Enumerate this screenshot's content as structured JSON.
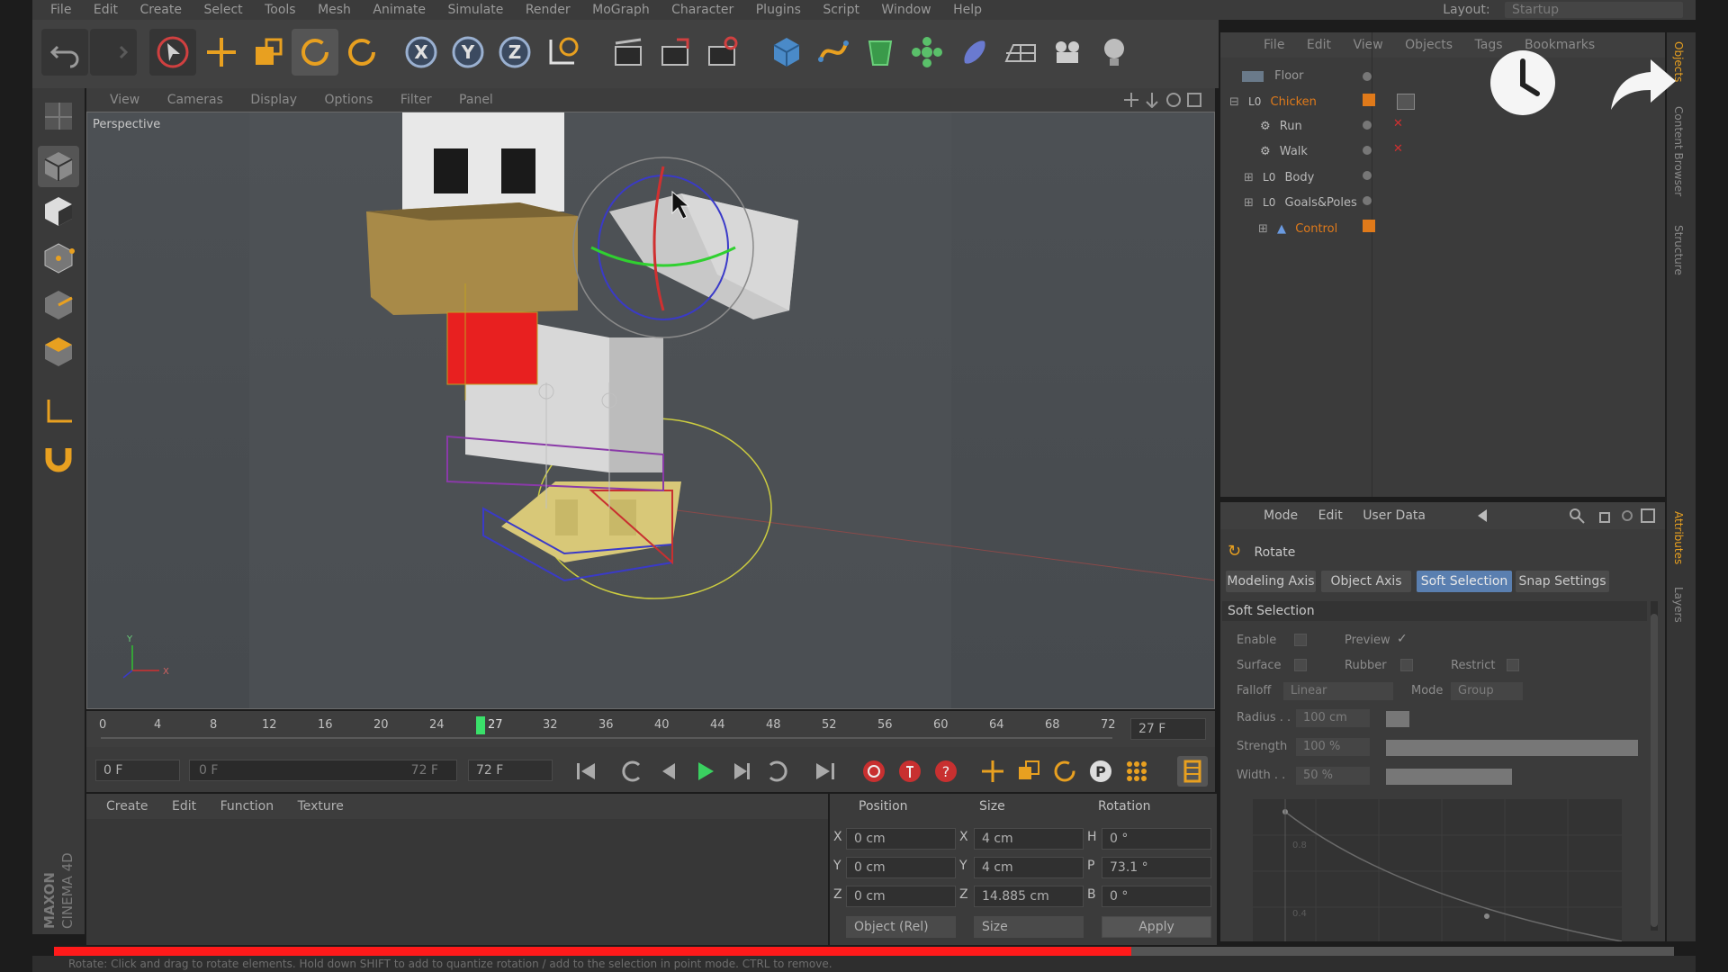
{
  "app": {
    "menu": [
      "File",
      "Edit",
      "Create",
      "Select",
      "Tools",
      "Mesh",
      "Animate",
      "Simulate",
      "Render",
      "MoGraph",
      "Character",
      "Plugins",
      "Script",
      "Window",
      "Help"
    ],
    "layout_label": "Layout:",
    "layout_value": "Startup",
    "brand_maxon": "MAXON",
    "brand_product": "CINEMA 4D"
  },
  "toolbar": {
    "icons": [
      "undo-icon",
      "redo-icon",
      "live-select-icon",
      "move-icon",
      "scale-icon",
      "rotate-icon",
      "recent-rotate-icon",
      "x-axis-lock-icon",
      "y-axis-lock-icon",
      "z-axis-lock-icon",
      "coordinate-system-icon",
      "render-view-icon",
      "render-picture-viewer-icon",
      "render-settings-icon",
      "cube-primitive-icon",
      "spline-icon",
      "nurbs-icon",
      "array-icon",
      "deformer-icon",
      "floor-icon",
      "camera-icon",
      "light-icon"
    ],
    "axis_x": "X",
    "axis_y": "Y",
    "axis_z": "Z"
  },
  "viewport": {
    "menu": [
      "View",
      "Cameras",
      "Display",
      "Options",
      "Filter",
      "Panel"
    ],
    "label": "Perspective",
    "axis_x": "X",
    "axis_y": "Y"
  },
  "timeline": {
    "ticks": [
      "0",
      "4",
      "8",
      "12",
      "16",
      "20",
      "24",
      "27",
      "32",
      "36",
      "40",
      "44",
      "48",
      "52",
      "56",
      "60",
      "64",
      "68",
      "72"
    ],
    "current_frame_field": "27 F",
    "start_field": "0 F",
    "range_start": "0 F",
    "range_end": "72 F",
    "end_field": "72 F"
  },
  "materials": {
    "menu": [
      "Create",
      "Edit",
      "Function",
      "Texture"
    ]
  },
  "coordinates": {
    "headers": [
      "Position",
      "Size",
      "Rotation"
    ],
    "rows": [
      {
        "pos_axis": "X",
        "pos": "0 cm",
        "size_axis": "X",
        "size": "4 cm",
        "rot_axis": "H",
        "rot": "0 °"
      },
      {
        "pos_axis": "Y",
        "pos": "0 cm",
        "size_axis": "Y",
        "size": "4 cm",
        "rot_axis": "P",
        "rot": "73.1 °"
      },
      {
        "pos_axis": "Z",
        "pos": "0 cm",
        "size_axis": "Z",
        "size": "14.885 cm",
        "rot_axis": "B",
        "rot": "0 °"
      }
    ],
    "mode_select": "Object (Rel)",
    "size_select": "Size",
    "apply": "Apply"
  },
  "object_manager": {
    "menu": [
      "File",
      "Edit",
      "View",
      "Objects",
      "Tags",
      "Bookmarks"
    ],
    "items": [
      {
        "label": "Floor",
        "color": "#9a9a9a"
      },
      {
        "label": "Chicken",
        "color": "#e07a1a"
      },
      {
        "label": "Run",
        "color": "#b8b8b8"
      },
      {
        "label": "Walk",
        "color": "#b8b8b8"
      },
      {
        "label": "Body",
        "color": "#b8b8b8"
      },
      {
        "label": "Goals&Poles",
        "color": "#b8b8b8"
      },
      {
        "label": "Control",
        "color": "#e07a1a"
      }
    ]
  },
  "right_tabs": {
    "top": [
      "Objects",
      "Content Browser",
      "Structure"
    ],
    "bottom": [
      "Attributes",
      "Layers"
    ]
  },
  "attributes": {
    "menu": [
      "Mode",
      "Edit",
      "User Data"
    ],
    "tool_name": "Rotate",
    "tabs": [
      "Modeling Axis",
      "Object Axis",
      "Soft Selection",
      "Snap Settings"
    ],
    "active_tab": "Soft Selection",
    "section": "Soft Selection",
    "enable": "Enable",
    "preview": "Preview",
    "surface": "Surface",
    "rubber": "Rubber",
    "restrict": "Restrict",
    "falloff": "Falloff",
    "falloff_value": "Linear",
    "mode": "Mode",
    "mode_value": "Group",
    "radius": "Radius . .",
    "radius_value": "100 cm",
    "strength": "Strength",
    "strength_value": "100 %",
    "width": "Width . .",
    "width_value": "50 %",
    "graph_y1": "0.8",
    "graph_y2": "0.4"
  },
  "status": {
    "text": "Rotate: Click and drag to rotate elements. Hold down SHIFT to add to quantize rotation / add to the selection in point mode. CTRL to remove."
  },
  "video": {
    "progress": 0.665,
    "watch_later_icon": "clock-icon",
    "share_icon": "share-arrow-icon"
  },
  "colors": {
    "accent": "#5a7fb0",
    "progress": "#ff1a1a",
    "orange": "#e07a1a"
  }
}
